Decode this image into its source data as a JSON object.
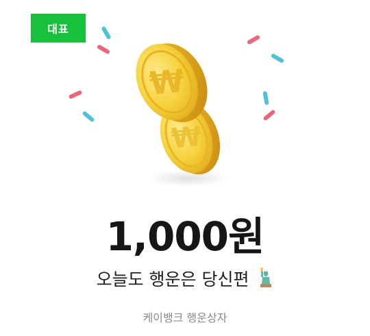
{
  "badge": {
    "label": "대표"
  },
  "prize": {
    "amount": "1,000원"
  },
  "message": {
    "text": "오늘도 행운은 당신편",
    "emoji_icon": "statue-of-liberty-icon"
  },
  "footer": {
    "text": "케이뱅크 행운상자"
  },
  "colors": {
    "badge_bg": "#17c13c",
    "confetti_pink": "#f0647a",
    "confetti_teal": "#4cc3d6",
    "coin_gold": "#f4cf3a"
  },
  "coin_icon": "won-coin-icon"
}
